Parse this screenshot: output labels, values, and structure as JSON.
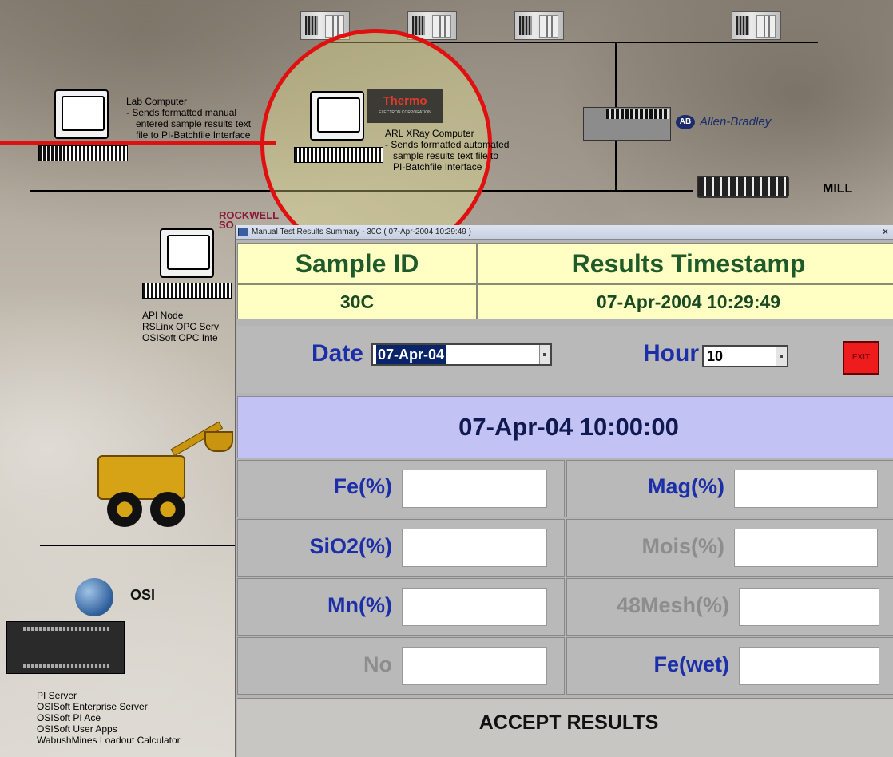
{
  "slide": {
    "lab_computer": [
      "Lab Computer",
      "- Sends formatted manual",
      "  entered sample results text",
      "  file to PI-Batchfile Interface"
    ],
    "xray_computer": [
      "ARL XRay Computer",
      "- Sends formatted automated",
      "  sample results text file to",
      "  PI-Batchfile Interface"
    ],
    "api_node": [
      "API Node",
      "RSLinx OPC Serv",
      "OSISoft OPC Inte"
    ],
    "pi_server": [
      "PI Server",
      "OSISoft Enterprise Server",
      "OSISoft PI Ace",
      "OSISoft User Apps",
      "WabushMines Loadout Calculator"
    ],
    "mill_label": "MILL",
    "allen_bradley": "Allen-Bradley",
    "ab_badge": "AB",
    "thermo": "Thermo",
    "thermo_sub": "ELECTRON CORPORATION",
    "rockwell": "ROCKWELL SO",
    "osi": "OSI",
    "colors": {
      "highlight_circle": "#e01010"
    }
  },
  "dialog": {
    "title": "Manual Test Results Summary - 30C ( 07-Apr-2004 10:29:49 )",
    "close_glyph": "×",
    "sample_id_header": "Sample ID",
    "timestamp_header": "Results Timestamp",
    "sample_id_value": "30C",
    "timestamp_value": "07-Apr-2004 10:29:49",
    "date_label": "Date",
    "date_value": "07-Apr-04",
    "hour_label": "Hour",
    "hour_value": "10",
    "exit_label": "EXIT",
    "selected_datetime": "07-Apr-04 10:00:00",
    "fields_left": [
      "Fe(%)",
      "SiO2(%)",
      "Mn(%)",
      "No"
    ],
    "fields_right": [
      "Mag(%)",
      "Mois(%)",
      "48Mesh(%)",
      "Fe(wet)"
    ],
    "accept_label": "ACCEPT RESULTS",
    "colors": {
      "header_bg": "#ffffc4",
      "header_text": "#1f5a2a",
      "datetime_bg": "#c2c2f4",
      "label_blue": "#1c2ea8"
    }
  }
}
